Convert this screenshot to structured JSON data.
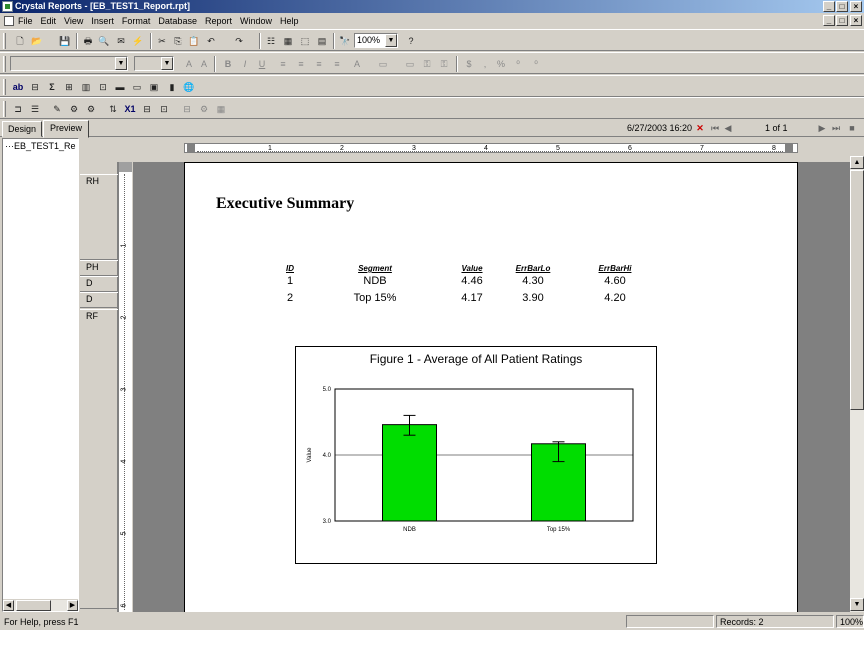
{
  "window": {
    "title": "Crystal Reports - [EB_TEST1_Report.rpt]"
  },
  "menu": [
    "File",
    "Edit",
    "View",
    "Insert",
    "Format",
    "Database",
    "Report",
    "Window",
    "Help"
  ],
  "toolbar": {
    "zoom": "100%"
  },
  "tabs": {
    "design": "Design",
    "preview": "Preview"
  },
  "nav": {
    "datetime": "6/27/2003  16:20",
    "page": "1 of 1"
  },
  "tree": {
    "node": "EB_TEST1_Re"
  },
  "sections": [
    "RH",
    "PH",
    "D",
    "D",
    "RF"
  ],
  "ruler": {
    "h": [
      "1",
      "2",
      "3",
      "4",
      "5",
      "6",
      "7",
      "8"
    ],
    "v": [
      "1",
      "2",
      "3",
      "4",
      "5",
      "6"
    ]
  },
  "report": {
    "title": "Executive Summary",
    "columns": [
      "ID",
      "Segment",
      "Value",
      "ErrBarLo",
      "ErrBarHi"
    ],
    "rows": [
      [
        "1",
        "NDB",
        "4.46",
        "4.30",
        "4.60"
      ],
      [
        "2",
        "Top 15%",
        "4.17",
        "3.90",
        "4.20"
      ]
    ]
  },
  "chart_data": {
    "type": "bar",
    "title": "Figure 1 - Average of All Patient Ratings",
    "categories": [
      "NDB",
      "Top 15%"
    ],
    "values": [
      4.46,
      4.17
    ],
    "error_low": [
      4.3,
      3.9
    ],
    "error_high": [
      4.6,
      4.2
    ],
    "ylabel": "Value",
    "xlabel": "",
    "ylim": [
      3.0,
      5.0
    ],
    "yticks": [
      "3.0",
      "4.0",
      "5.0"
    ],
    "bar_color": "#00dd00",
    "grid": true
  },
  "status": {
    "help": "For Help, press F1",
    "records": "Records:  2",
    "zoom": "100%"
  }
}
